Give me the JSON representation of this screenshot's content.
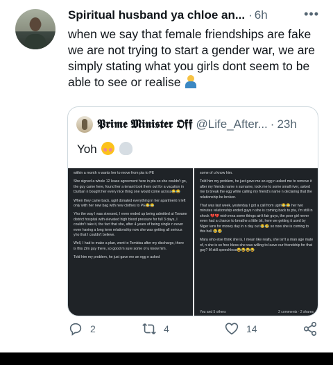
{
  "tweet": {
    "display_name": "Spiritual husband ya chloe an...",
    "separator": "·",
    "time": "6h",
    "more": "•••",
    "text": "when we say that female friendships are fake we are not trying to start a gender war, we are simply stating what you girls dont seem to be able to see or realise"
  },
  "quote": {
    "display_name": "𝕻𝖗𝖎𝖒𝖊 𝕸𝖎𝖓𝖎𝖘𝖙𝖊𝖗 𝕺𝖋𝖋",
    "handle": "@Life_After...",
    "separator": "·",
    "time": "23h",
    "text": "Yoh",
    "images": {
      "left": [
        "within a month n wants her to move from pta to PE",
        "She signed a whole 12 lease agreement here in pta so she couldn't go, the guy came here, found her a tenant took them out for a vacation in Durban n bought her every nice thing one would come across😂😂",
        "When they came back, ugirl donated everything in her apartment n left only with her new bag with new clothes to PE😂😂",
        "Yho the way I was stressed, I even ended up being admitted at Tswane district hospital with elevated high blood pressure for full 3 days, I couldn't take it, the fact that she, after 4 years of being single n never even having a long term relationship now she was getting all serious yho that I couldn't believe.",
        "Well, I had to make a plan, went to Tembisa after my discharge, there is this Zim guy there, so good m sure some of u know him.",
        "Told him my problem, he just gave me an egg n asked"
      ],
      "right": [
        "some of u know him.",
        "Told him my problem, he just gave me an egg n asked me to remove it after my friends name n surname, took me to some small river, asked me to break the egg while calling my friend's name n declaring that the relationship be broken.",
        "That was last week, yesterday I got a call from ugirl😂😂 her two minutes relationship ended guys n she is coming back to pta, i'm still in shock 💔💔 wish mna some things ain't fair guys, the poor girl never even had a chance to breathe a little bit, here we getting it used by Niger ians for money day in n day out 😂😂 so now she is coming to this hell 😂😂",
        "Mara who else think she is, I mean like really, she isn't a man age mate of, n she is so free bless she was willing to leave our friendship for that guy? M still speechless😂😂😂😂"
      ],
      "foot_left": "You and 5 others",
      "foot_right": "2 comments · 2 shares"
    }
  },
  "actions": {
    "replies": "2",
    "retweets": "4",
    "likes": "14"
  },
  "colors": {
    "text": "#0f1419",
    "muted": "#536471",
    "border": "#cfd9de",
    "image_bg": "#1f2327"
  }
}
